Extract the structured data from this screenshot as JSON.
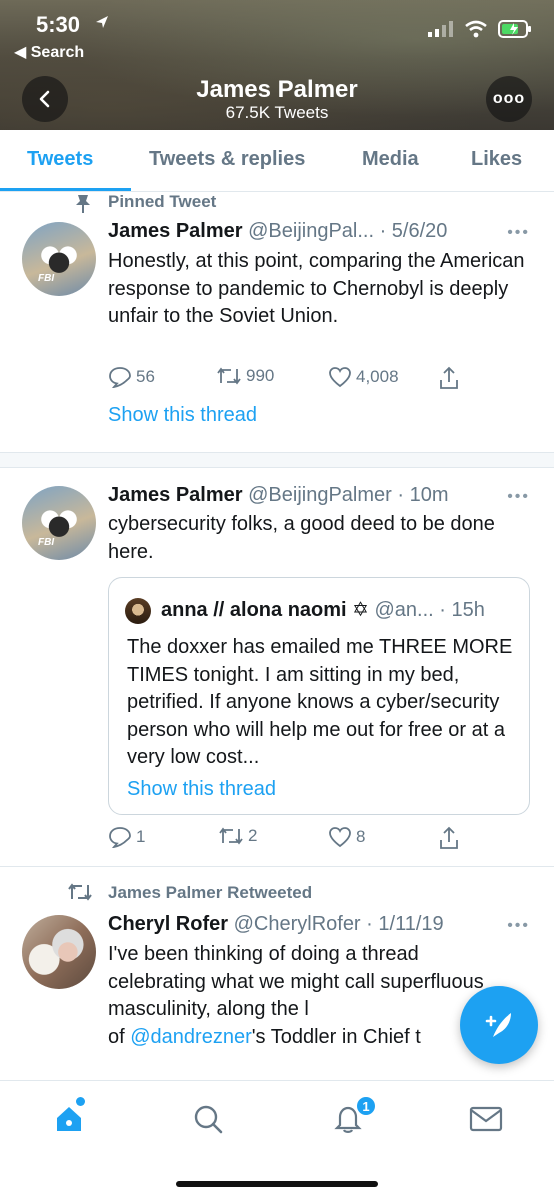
{
  "status_bar": {
    "time": "5:30",
    "back_app": "◀ Search"
  },
  "header": {
    "name": "James Palmer",
    "tweet_count": "67.5K Tweets",
    "more_label": "ooo"
  },
  "tabs": [
    {
      "label": "Tweets",
      "active": true
    },
    {
      "label": "Tweets & replies"
    },
    {
      "label": "Media"
    },
    {
      "label": "Likes"
    }
  ],
  "tweets": [
    {
      "pinned_label": "Pinned Tweet",
      "name": "James Palmer",
      "handle": "@BeijingPal...",
      "time": "· 5/6/20",
      "body": "Honestly, at this point, comparing the American response to pandemic to Chernobyl is deeply unfair to the Soviet Union.",
      "replies": "56",
      "retweets": "990",
      "likes": "4,008",
      "show_thread": "Show this thread"
    },
    {
      "name": "James Palmer",
      "handle": "@BeijingPalmer",
      "time": "· 10m",
      "body": "cybersecurity folks, a good deed to be done here.",
      "quote": {
        "name": "anna // alona naomi ✡",
        "handle": "@an...",
        "time": "· 15h",
        "body": "The doxxer has emailed me THREE MORE TIMES tonight. I am sitting in my bed, petrified. If anyone knows a cyber/security person who will help me out for free or at a very low cost...",
        "show_thread": "Show this thread"
      },
      "replies": "1",
      "retweets": "2",
      "likes": "8"
    },
    {
      "retweeted_label": "James Palmer Retweeted",
      "name": "Cheryl Rofer",
      "handle": "@CherylRofer",
      "time": "· 1/11/19",
      "body_before": "I've been thinking of doing a thread celebrating what we might call superfluous masculinity, along the l",
      "body_of": "of ",
      "mention": "@dandrezner",
      "body_after": "'s Toddler in Chief t"
    }
  ],
  "nav": {
    "notification_count": "1"
  },
  "colors": {
    "accent": "#1da1f2",
    "secondary_text": "#657786"
  }
}
